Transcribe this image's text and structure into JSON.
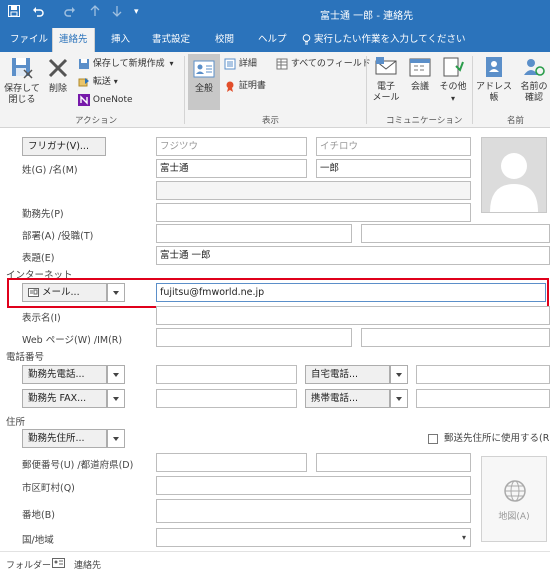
{
  "window": {
    "title": "富士通 一郎 - 連絡先"
  },
  "tabs": [
    "ファイル",
    "連絡先",
    "挿入",
    "書式設定",
    "校閲",
    "ヘルプ"
  ],
  "tell_me": "実行したい作業を入力してください",
  "ribbon": {
    "save_close_1": "保存して",
    "save_close_2": "閉じる",
    "delete": "削除",
    "save_new": "保存して新規作成",
    "forward": "転送",
    "onenote": "OneNote",
    "group_action": "アクション",
    "general": "全般",
    "details": "詳細",
    "certificates": "証明書",
    "all_fields": "すべてのフィールド",
    "group_show": "表示",
    "email_1": "電子",
    "email_2": "メール",
    "meeting": "会議",
    "more": "その他",
    "group_comm": "コミュニケーション",
    "address_book": "アドレス帳",
    "check_names_1": "名前の",
    "check_names_2": "確認",
    "group_names": "名前"
  },
  "form": {
    "furigana_btn": "フリガナ(V)...",
    "furigana_last": "フジツウ",
    "furigana_first": "イチロウ",
    "name_label": "姓(G) /名(M)",
    "last_name": "富士通",
    "first_name": "一郎",
    "company_label": "勤務先(P)",
    "dept_label": "部署(A) /役職(T)",
    "fileas_label": "表題(E)",
    "file_as": "富士通 一郎",
    "internet_section": "インターネット",
    "email_btn": "メール...",
    "email_value": "fujitsu@fmworld.ne.jp",
    "display_label": "表示名(I)",
    "web_label": "Web ページ(W) /IM(R)",
    "phone_section": "電話番号",
    "business_phone": "勤務先電話...",
    "home_phone": "自宅電話...",
    "business_fax": "勤務先 FAX...",
    "mobile_phone": "携帯電話...",
    "address_section": "住所",
    "business_address": "勤務先住所...",
    "mailing_checkbox": "郵送先住所に使用する(R)",
    "postal_label": "郵便番号(U) /都道府県(D)",
    "city_label": "市区町村(Q)",
    "street_label": "番地(B)",
    "country_label": "国/地域",
    "map_btn": "地図(A)"
  },
  "footer": {
    "folder_label": "フォルダー",
    "folder_value": "連絡先"
  },
  "colors": {
    "accent": "#2b73bb",
    "highlight_border": "#e0001b"
  },
  "icons": [
    "save-icon",
    "undo-icon",
    "redo-icon",
    "up-icon",
    "down-icon",
    "lightbulb-icon",
    "contact-card-icon",
    "certificate-icon",
    "email-icon",
    "meeting-icon",
    "address-book-icon",
    "globe-icon",
    "person-photo-icon"
  ]
}
